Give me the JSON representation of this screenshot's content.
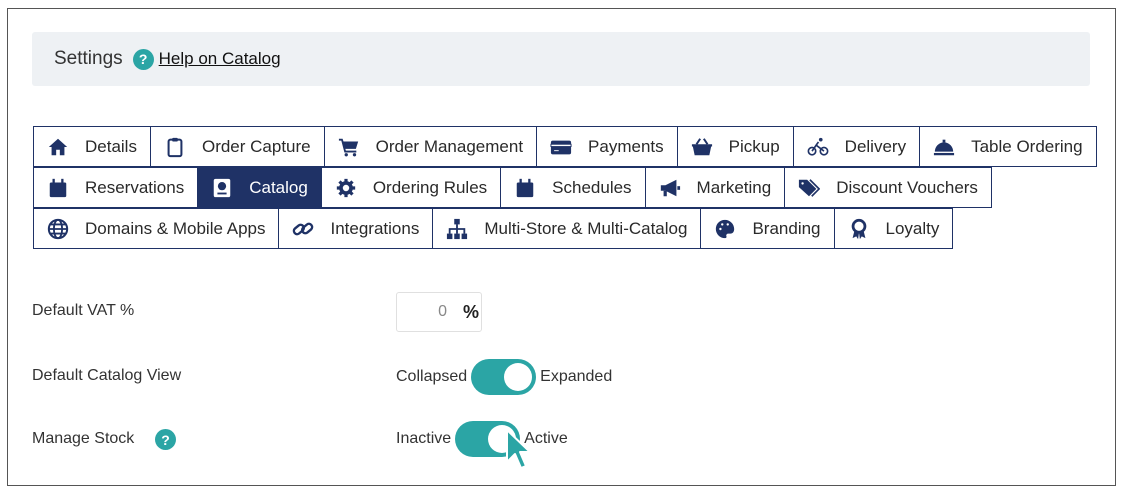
{
  "header": {
    "title": "Settings",
    "help_link": "Help on Catalog"
  },
  "tabs": {
    "row1": [
      {
        "label": "Details",
        "icon": "home-icon"
      },
      {
        "label": "Order Capture",
        "icon": "clipboard-icon"
      },
      {
        "label": "Order Management",
        "icon": "cart-icon"
      },
      {
        "label": "Payments",
        "icon": "credit-card-icon"
      },
      {
        "label": "Pickup",
        "icon": "basket-icon"
      },
      {
        "label": "Delivery",
        "icon": "bicycle-icon"
      },
      {
        "label": "Table Ordering",
        "icon": "cloche-icon"
      }
    ],
    "row2": [
      {
        "label": "Reservations",
        "icon": "calendar-icon"
      },
      {
        "label": "Catalog",
        "icon": "catalog-book-icon",
        "active": true
      },
      {
        "label": "Ordering Rules",
        "icon": "gear-icon"
      },
      {
        "label": "Schedules",
        "icon": "calendar-icon"
      },
      {
        "label": "Marketing",
        "icon": "megaphone-icon"
      },
      {
        "label": "Discount Vouchers",
        "icon": "tags-icon"
      }
    ],
    "row3": [
      {
        "label": "Domains & Mobile Apps",
        "icon": "globe-icon"
      },
      {
        "label": "Integrations",
        "icon": "link-icon"
      },
      {
        "label": "Multi-Store & Multi-Catalog",
        "icon": "sitemap-icon"
      },
      {
        "label": "Branding",
        "icon": "palette-icon"
      },
      {
        "label": "Loyalty",
        "icon": "award-icon"
      }
    ]
  },
  "settings": {
    "vat": {
      "label": "Default VAT %",
      "value": "0",
      "unit": "%"
    },
    "catalog_view": {
      "label": "Default Catalog View",
      "off_label": "Collapsed",
      "on_label": "Expanded",
      "state": "on"
    },
    "manage_stock": {
      "label": "Manage Stock",
      "off_label": "Inactive",
      "on_label": "Active",
      "state": "on"
    }
  },
  "colors": {
    "accent": "#2ba5a5",
    "navy": "#1f3266",
    "header_bg": "#eef1f4"
  }
}
